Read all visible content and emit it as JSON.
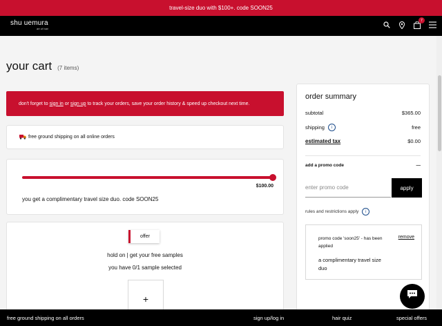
{
  "promo_bar": {
    "text": "travel-size duo with $100+. code SOON25"
  },
  "header": {
    "logo_main": "shu uemura",
    "logo_sub": "art of hair",
    "cart_count": "7",
    "icons": [
      "search-icon",
      "location-icon",
      "cart-icon",
      "menu-icon"
    ]
  },
  "cart": {
    "title": "your cart",
    "count_label": "(7 items)"
  },
  "signin_banner": {
    "prefix": "don't forget to",
    "sign_in": "sign in",
    "or": "or",
    "sign_up": "sign up",
    "suffix": "to track your orders, save your order history & speed up checkout next time."
  },
  "shipping_notice": {
    "icon": "truck-icon",
    "text": "free ground shipping on all online orders"
  },
  "progress": {
    "threshold": "$100.00",
    "fill_fraction": 1.0,
    "message": "you get a complimentary travel size duo. code SOON25"
  },
  "offer": {
    "tab": "offer",
    "title": "hold on | get your free samples",
    "subtitle": "you have 0/1 sample selected",
    "add_symbol": "+"
  },
  "summary": {
    "title": "order summary",
    "subtotal_label": "subtotal",
    "subtotal_value": "$365.00",
    "shipping_label": "shipping",
    "shipping_value": "free",
    "tax_label": "estimated tax",
    "tax_value": "$0.00",
    "promo_head": "add a promo code",
    "promo_toggle": "—",
    "promo_placeholder": "enter promo code",
    "apply_label": "apply",
    "rules_label": "rules and restrictions apply",
    "applied_text": "promo code 'soon25' - has been applied",
    "remove_label": "remove",
    "applied_gift": "a complimentary travel size duo"
  },
  "footer": {
    "shipping": "free ground shipping on all orders",
    "signin": "sign up/log in",
    "quiz": "hair quiz",
    "offers": "special offers"
  },
  "colors": {
    "brand_red": "#c8102e",
    "black": "#000000",
    "info_blue": "#1a4b8a"
  }
}
